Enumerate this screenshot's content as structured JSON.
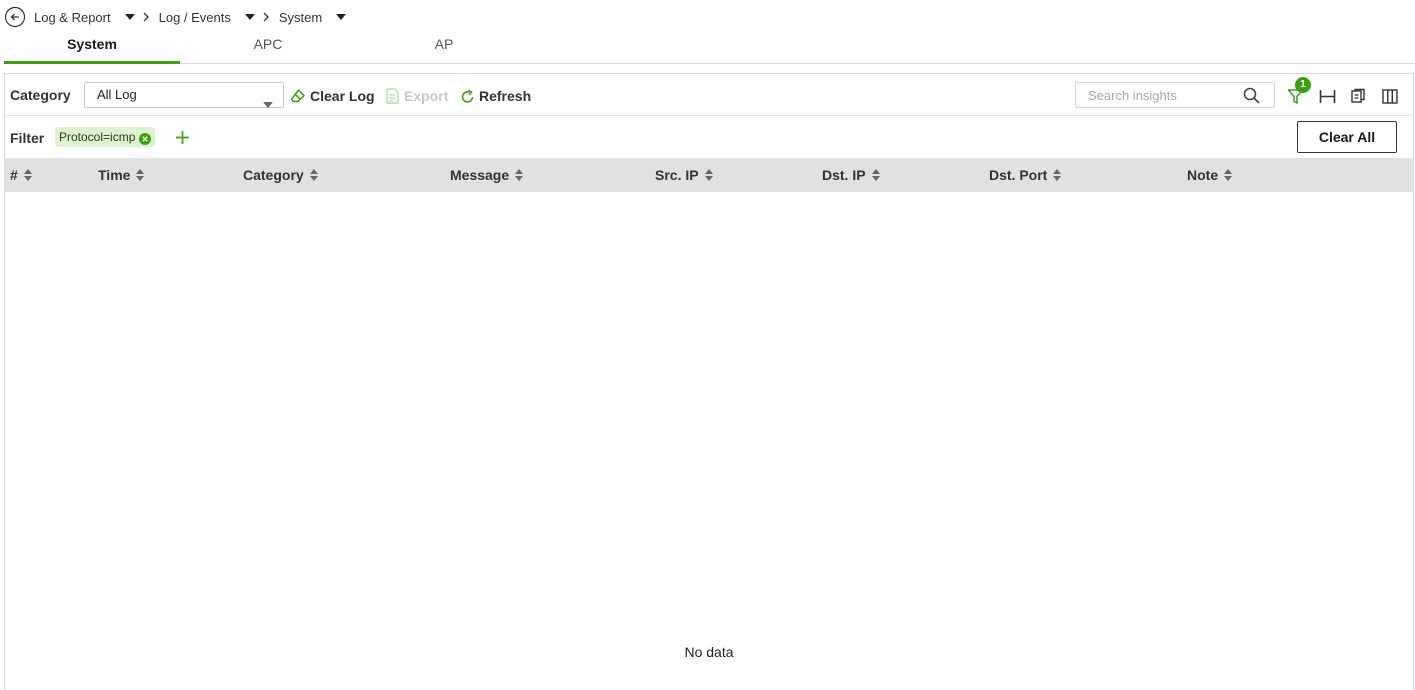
{
  "breadcrumb": {
    "items": [
      "Log & Report",
      "Log / Events",
      "System"
    ]
  },
  "tabs": [
    {
      "label": "System",
      "active": true
    },
    {
      "label": "APC",
      "active": false
    },
    {
      "label": "AP",
      "active": false
    }
  ],
  "toolbar": {
    "category_label": "Category",
    "category_value": "All Log",
    "clear_log_label": "Clear Log",
    "export_label": "Export",
    "refresh_label": "Refresh",
    "search_placeholder": "Search insights",
    "filter_badge_count": "1"
  },
  "filter": {
    "label": "Filter",
    "chips": [
      "Protocol=icmp"
    ],
    "clear_all_label": "Clear All"
  },
  "table": {
    "columns": [
      "#",
      "Time",
      "Category",
      "Message",
      "Src. IP",
      "Dst. IP",
      "Dst. Port",
      "Note"
    ],
    "rows": [],
    "empty_text": "No data"
  },
  "colors": {
    "accent": "#3aa012",
    "header_bg": "#e1e1e1",
    "chip_bg": "#dff2d0"
  },
  "icons": [
    "back-arrow-icon",
    "caret-down-icon",
    "chevron-right-icon",
    "eraser-icon",
    "export-icon",
    "refresh-icon",
    "search-icon",
    "filter-icon",
    "fit-width-icon",
    "copy-icon",
    "columns-icon",
    "close-circle-icon",
    "plus-icon",
    "sort-icon"
  ]
}
